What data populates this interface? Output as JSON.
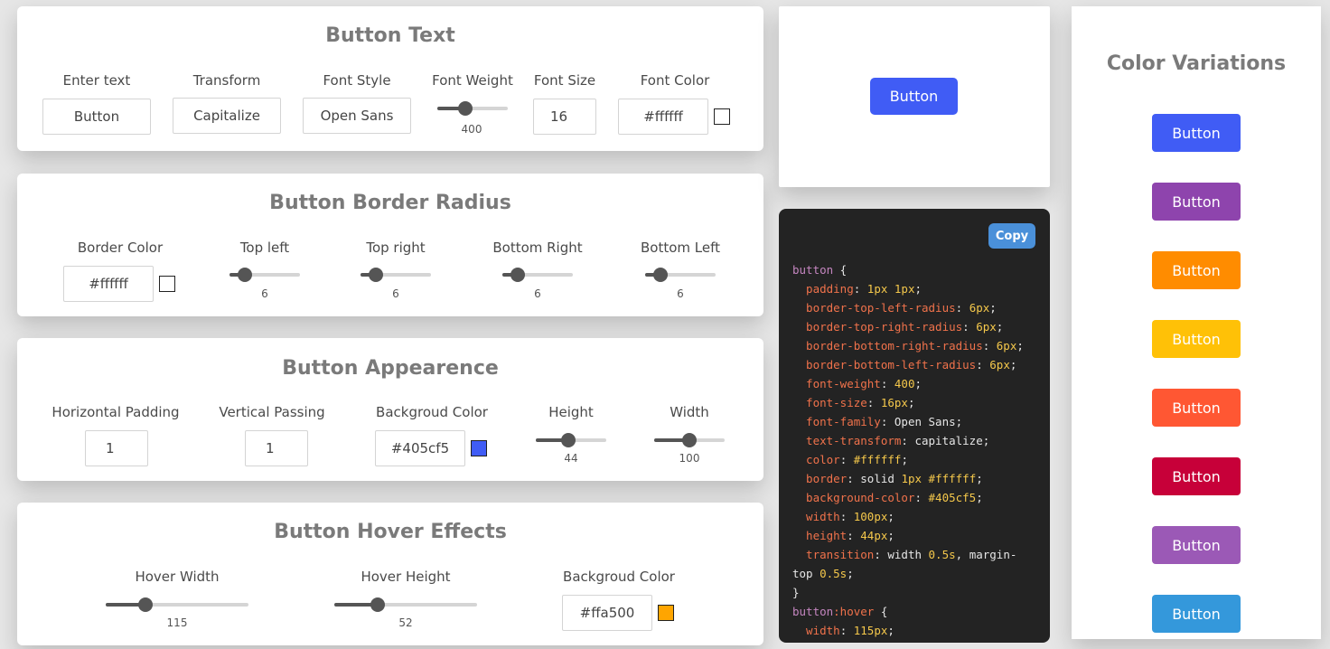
{
  "text_card": {
    "title": "Button Text",
    "enter_text": {
      "label": "Enter text",
      "value": "Button"
    },
    "transform": {
      "label": "Transform",
      "value": "Capitalize"
    },
    "font_style": {
      "label": "Font Style",
      "value": "Open Sans"
    },
    "font_weight": {
      "label": "Font Weight",
      "value": "400",
      "min": 100,
      "max": 900,
      "level": 400
    },
    "font_size": {
      "label": "Font Size",
      "value": "16"
    },
    "font_color": {
      "label": "Font Color",
      "value": "#ffffff",
      "swatch": "#ffffff"
    }
  },
  "radius_card": {
    "title": "Button Border Radius",
    "border_color": {
      "label": "Border Color",
      "value": "#ffffff",
      "swatch": "#ffffff"
    },
    "top_left": {
      "label": "Top left",
      "value": "6",
      "fraction": 0.15
    },
    "top_right": {
      "label": "Top right",
      "value": "6",
      "fraction": 0.15
    },
    "bottom_right": {
      "label": "Bottom Right",
      "value": "6",
      "fraction": 0.15
    },
    "bottom_left": {
      "label": "Bottom Left",
      "value": "6",
      "fraction": 0.15
    }
  },
  "appearance_card": {
    "title": "Button Appearence",
    "horizontal_padding": {
      "label": "Horizontal Padding",
      "value": "1"
    },
    "vertical_padding": {
      "label": "Vertical Passing",
      "value": "1"
    },
    "background_color": {
      "label": "Backgroud Color",
      "value": "#405cf5",
      "swatch": "#405cf5"
    },
    "height": {
      "label": "Height",
      "value": "44",
      "fraction": 0.45
    },
    "width": {
      "label": "Width",
      "value": "100",
      "fraction": 0.5
    }
  },
  "hover_card": {
    "title": "Button Hover Effects",
    "hover_width": {
      "label": "Hover Width",
      "value": "115",
      "fraction": 0.25
    },
    "hover_height": {
      "label": "Hover Height",
      "value": "52",
      "fraction": 0.28
    },
    "background_color": {
      "label": "Backgroud Color",
      "value": "#ffa500",
      "swatch": "#ffa500"
    }
  },
  "preview": {
    "label": "Button",
    "color": "#405cf5"
  },
  "code_panel": {
    "copy_label": "Copy",
    "lines": [
      [
        {
          "t": "button",
          "c": "sel"
        },
        {
          "t": " {",
          "c": "val"
        }
      ],
      [
        {
          "t": "  padding",
          "c": "prop"
        },
        {
          "t": ": ",
          "c": "val"
        },
        {
          "t": "1px 1px",
          "c": "num"
        },
        {
          "t": ";",
          "c": "val"
        }
      ],
      [
        {
          "t": "  border-top-left-radius",
          "c": "prop"
        },
        {
          "t": ": ",
          "c": "val"
        },
        {
          "t": "6px",
          "c": "num"
        },
        {
          "t": ";",
          "c": "val"
        }
      ],
      [
        {
          "t": "  border-top-right-radius",
          "c": "prop"
        },
        {
          "t": ": ",
          "c": "val"
        },
        {
          "t": "6px",
          "c": "num"
        },
        {
          "t": ";",
          "c": "val"
        }
      ],
      [
        {
          "t": "  border-bottom-right-radius",
          "c": "prop"
        },
        {
          "t": ": ",
          "c": "val"
        },
        {
          "t": "6px",
          "c": "num"
        },
        {
          "t": ";",
          "c": "val"
        }
      ],
      [
        {
          "t": "  border-bottom-left-radius",
          "c": "prop"
        },
        {
          "t": ": ",
          "c": "val"
        },
        {
          "t": "6px",
          "c": "num"
        },
        {
          "t": ";",
          "c": "val"
        }
      ],
      [
        {
          "t": "  font-weight",
          "c": "prop"
        },
        {
          "t": ": ",
          "c": "val"
        },
        {
          "t": "400",
          "c": "num"
        },
        {
          "t": ";",
          "c": "val"
        }
      ],
      [
        {
          "t": "  font-size",
          "c": "prop"
        },
        {
          "t": ": ",
          "c": "val"
        },
        {
          "t": "16px",
          "c": "num"
        },
        {
          "t": ";",
          "c": "val"
        }
      ],
      [
        {
          "t": "  font-family",
          "c": "prop"
        },
        {
          "t": ": Open Sans;",
          "c": "val"
        }
      ],
      [
        {
          "t": "  text-transform",
          "c": "prop"
        },
        {
          "t": ": capitalize;",
          "c": "val"
        }
      ],
      [
        {
          "t": "  color",
          "c": "prop"
        },
        {
          "t": ": ",
          "c": "val"
        },
        {
          "t": "#ffffff",
          "c": "num"
        },
        {
          "t": ";",
          "c": "val"
        }
      ],
      [
        {
          "t": "  border",
          "c": "prop"
        },
        {
          "t": ": solid ",
          "c": "val"
        },
        {
          "t": "1px #ffffff",
          "c": "num"
        },
        {
          "t": ";",
          "c": "val"
        }
      ],
      [
        {
          "t": "  background-color",
          "c": "prop"
        },
        {
          "t": ": ",
          "c": "val"
        },
        {
          "t": "#405cf5",
          "c": "num"
        },
        {
          "t": ";",
          "c": "val"
        }
      ],
      [
        {
          "t": "  width",
          "c": "prop"
        },
        {
          "t": ": ",
          "c": "val"
        },
        {
          "t": "100px",
          "c": "num"
        },
        {
          "t": ";",
          "c": "val"
        }
      ],
      [
        {
          "t": "  height",
          "c": "prop"
        },
        {
          "t": ": ",
          "c": "val"
        },
        {
          "t": "44px",
          "c": "num"
        },
        {
          "t": ";",
          "c": "val"
        }
      ],
      [
        {
          "t": "  transition",
          "c": "prop"
        },
        {
          "t": ": width ",
          "c": "val"
        },
        {
          "t": "0.5s",
          "c": "num"
        },
        {
          "t": ", margin-",
          "c": "val"
        }
      ],
      [
        {
          "t": "top ",
          "c": "val"
        },
        {
          "t": "0.5s",
          "c": "num"
        },
        {
          "t": ";",
          "c": "val"
        }
      ],
      [
        {
          "t": "}",
          "c": "val"
        }
      ],
      [
        {
          "t": "button",
          "c": "sel"
        },
        {
          "t": ":hover",
          "c": "prop"
        },
        {
          "t": " {",
          "c": "val"
        }
      ],
      [
        {
          "t": "  width",
          "c": "prop"
        },
        {
          "t": ": ",
          "c": "val"
        },
        {
          "t": "115px",
          "c": "num"
        },
        {
          "t": ";",
          "c": "val"
        }
      ]
    ]
  },
  "variations": {
    "title": "Color Variations",
    "buttons": [
      {
        "label": "Button",
        "color": "#405cf5"
      },
      {
        "label": "Button",
        "color": "#8e44ad"
      },
      {
        "label": "Button",
        "color": "#ff8c00"
      },
      {
        "label": "Button",
        "color": "#ffc107"
      },
      {
        "label": "Button",
        "color": "#ff5733"
      },
      {
        "label": "Button",
        "color": "#c70039"
      },
      {
        "label": "Button",
        "color": "#9b59b6"
      },
      {
        "label": "Button",
        "color": "#3498db"
      }
    ]
  }
}
